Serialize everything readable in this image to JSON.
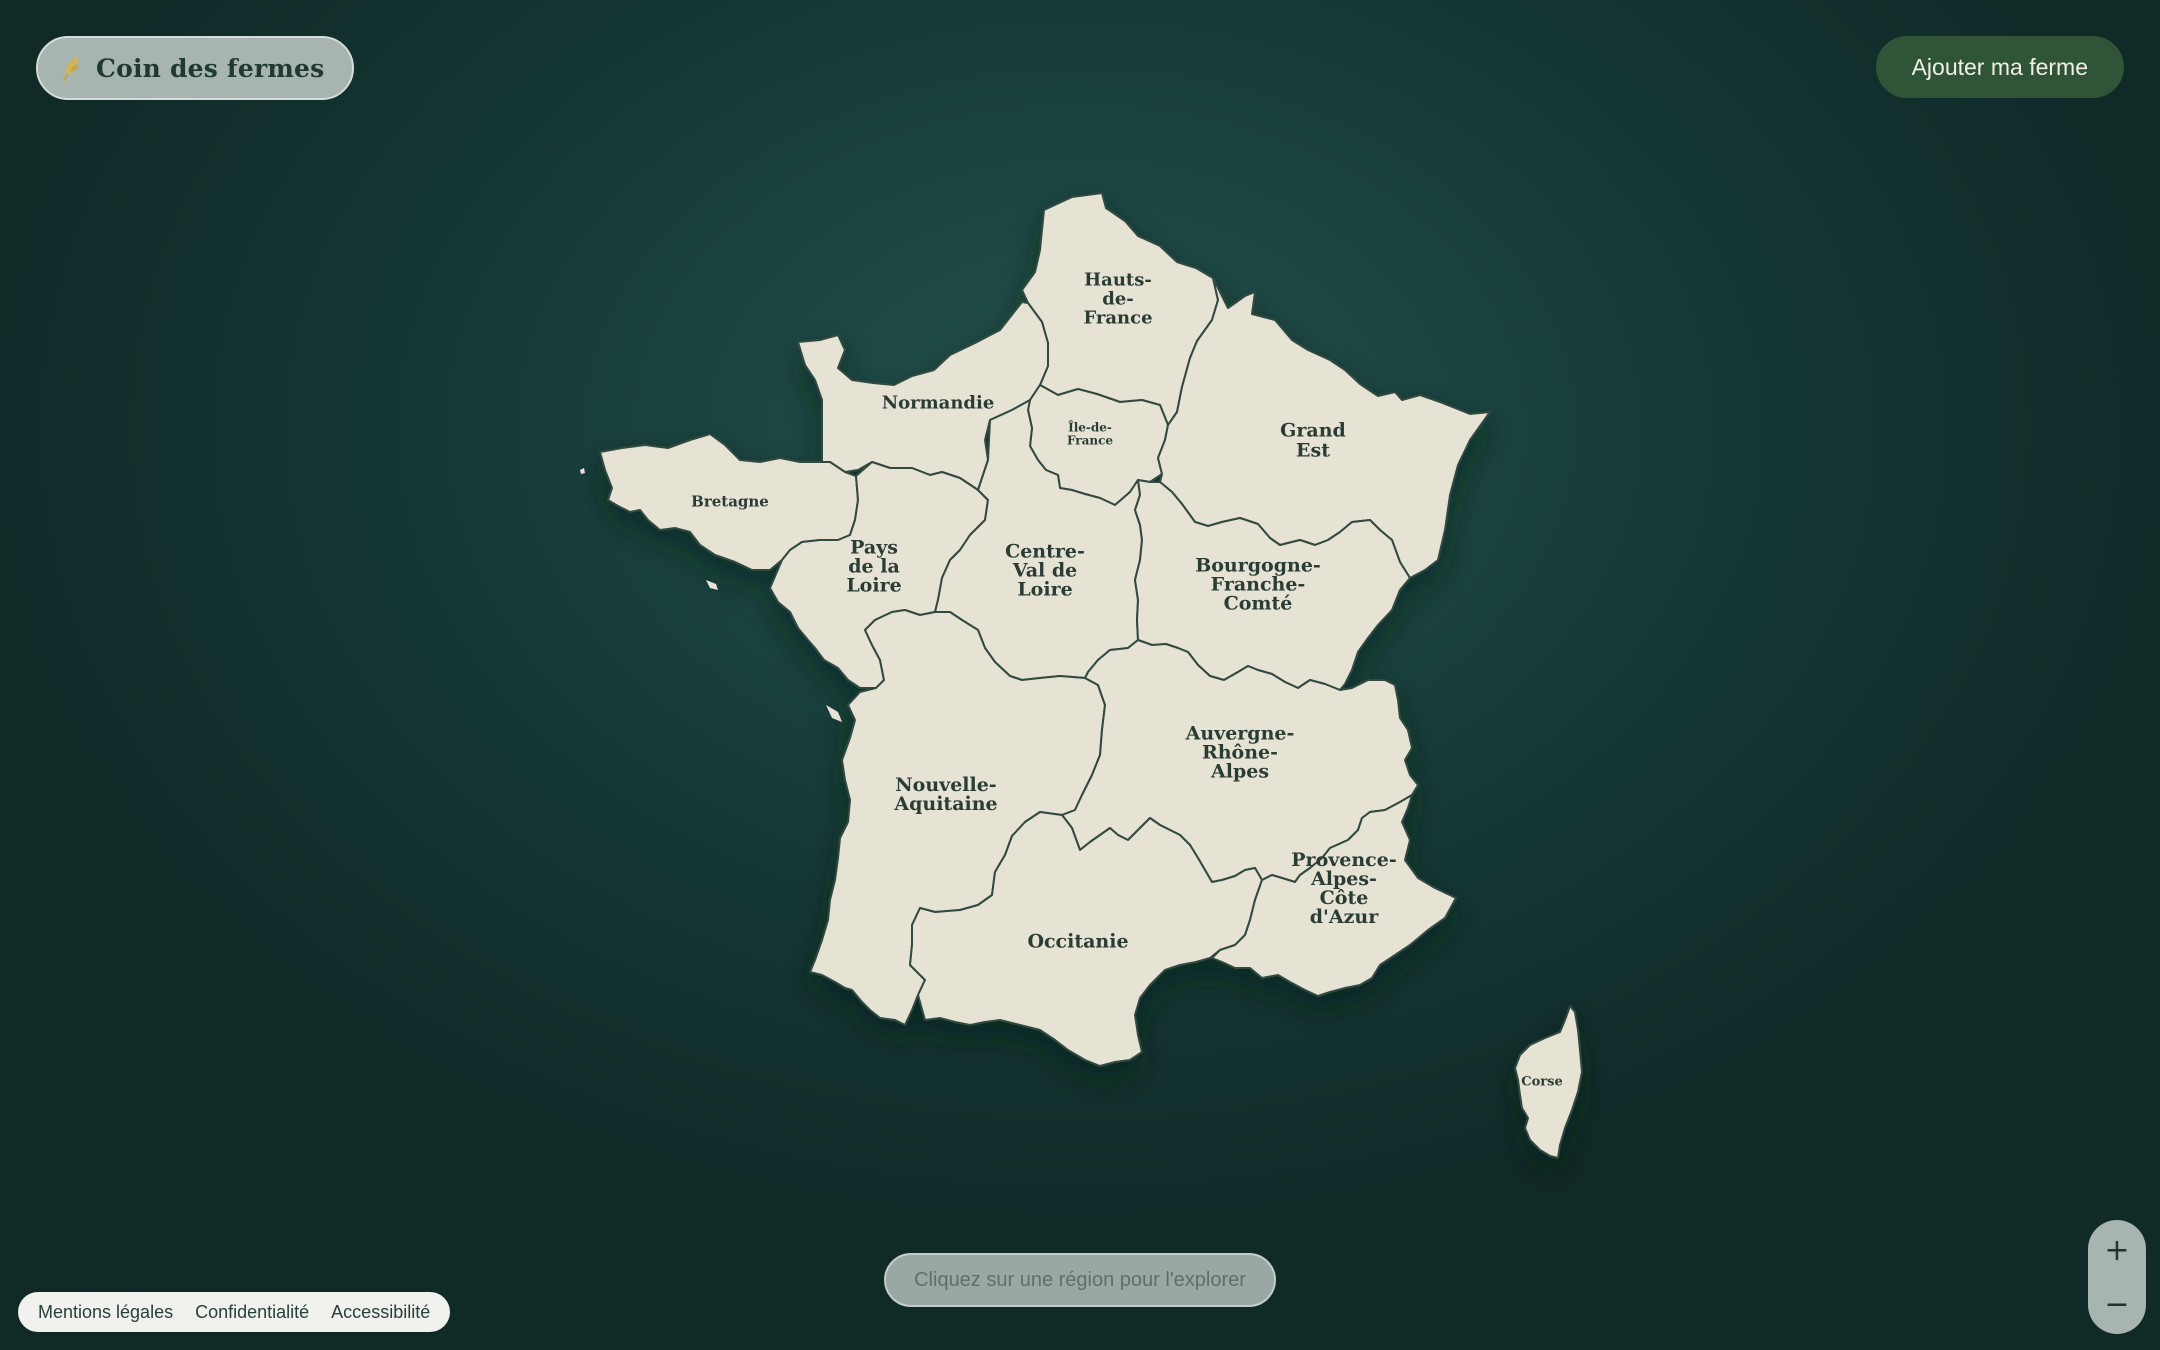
{
  "header": {
    "brand_name": "Coin des fermes",
    "brand_icon": "wheat-icon",
    "cta_label": "Ajouter ma ferme"
  },
  "map": {
    "country": "France",
    "regions": [
      {
        "id": "hauts-de-france",
        "name": "Hauts-de-France",
        "label_lines": [
          "Hauts-",
          "de-",
          "France"
        ]
      },
      {
        "id": "normandie",
        "name": "Normandie",
        "label_lines": [
          "Normandie"
        ]
      },
      {
        "id": "ile-de-france",
        "name": "Île-de-France",
        "label_lines": [
          "Île-de-",
          "France"
        ]
      },
      {
        "id": "grand-est",
        "name": "Grand Est",
        "label_lines": [
          "Grand",
          "Est"
        ]
      },
      {
        "id": "bretagne",
        "name": "Bretagne",
        "label_lines": [
          "Bretagne"
        ]
      },
      {
        "id": "pays-de-la-loire",
        "name": "Pays de la Loire",
        "label_lines": [
          "Pays",
          "de la",
          "Loire"
        ]
      },
      {
        "id": "centre-val-de-loire",
        "name": "Centre-Val de Loire",
        "label_lines": [
          "Centre-",
          "Val de",
          "Loire"
        ]
      },
      {
        "id": "bourgogne-franche-comte",
        "name": "Bourgogne-Franche-Comté",
        "label_lines": [
          "Bourgogne-",
          "Franche-",
          "Comté"
        ]
      },
      {
        "id": "nouvelle-aquitaine",
        "name": "Nouvelle-Aquitaine",
        "label_lines": [
          "Nouvelle-",
          "Aquitaine"
        ]
      },
      {
        "id": "auvergne-rhone-alpes",
        "name": "Auvergne-Rhône-Alpes",
        "label_lines": [
          "Auvergne-",
          "Rhône-",
          "Alpes"
        ]
      },
      {
        "id": "occitanie",
        "name": "Occitanie",
        "label_lines": [
          "Occitanie"
        ]
      },
      {
        "id": "provence-alpes-cote-dazur",
        "name": "Provence-Alpes-Côte d'Azur",
        "label_lines": [
          "Provence-",
          "Alpes-",
          "Côte",
          "d'Azur"
        ]
      },
      {
        "id": "corse",
        "name": "Corse",
        "label_lines": [
          "Corse"
        ]
      }
    ],
    "hint": "Cliquez sur une région pour l'explorer"
  },
  "footer": {
    "links": [
      "Mentions légales",
      "Confidentialité",
      "Accessibilité"
    ]
  },
  "zoom": {
    "in_label": "+",
    "out_label": "−"
  },
  "colors": {
    "background": "#1a433f",
    "land": "#e6e2d4",
    "border": "#314a42",
    "cta": "#2f5437"
  }
}
